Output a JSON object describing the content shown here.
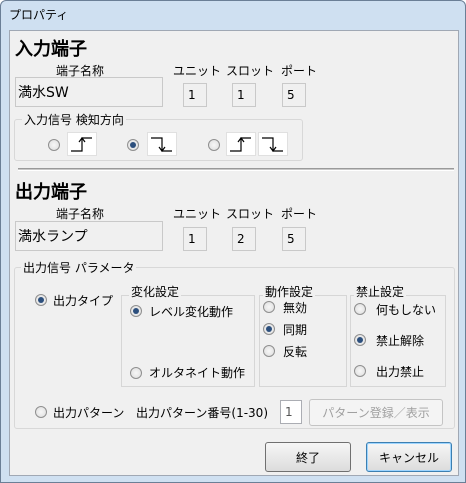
{
  "window": {
    "title": "プロパティ"
  },
  "input_terminal": {
    "heading": "入力端子",
    "name_label": "端子名称",
    "unit_label": "ユニット",
    "slot_label": "スロット",
    "port_label": "ポート",
    "name": "満水SW",
    "unit": "1",
    "slot": "1",
    "port": "5",
    "detect_group_label": "入力信号 検知方向",
    "detect_options": [
      {
        "icon": "rising-edge-icon",
        "checked": false
      },
      {
        "icon": "falling-edge-icon",
        "checked": true
      },
      {
        "icon": "both-edges-icon",
        "checked": false
      }
    ]
  },
  "output_terminal": {
    "heading": "出力端子",
    "name_label": "端子名称",
    "unit_label": "ユニット",
    "slot_label": "スロット",
    "port_label": "ポート",
    "name": "満水ランプ",
    "unit": "1",
    "slot": "2",
    "port": "5"
  },
  "output_params": {
    "group_label": "出力信号 パラメータ",
    "output_type_label": "出力タイプ",
    "output_type_checked": true,
    "change_group_label": "変化設定",
    "level_change_label": "レベル変化動作",
    "level_change_checked": true,
    "alternate_label": "オルタネイト動作",
    "alternate_checked": false,
    "action_group_label": "動作設定",
    "action_options": [
      {
        "label": "無効",
        "checked": false
      },
      {
        "label": "同期",
        "checked": true
      },
      {
        "label": "反転",
        "checked": false
      }
    ],
    "prohibit_group_label": "禁止設定",
    "prohibit_options": [
      {
        "label": "何もしない",
        "checked": false
      },
      {
        "label": "禁止解除",
        "checked": true
      },
      {
        "label": "出力禁止",
        "checked": false
      }
    ],
    "output_pattern_label": "出力パターン",
    "output_pattern_checked": false,
    "pattern_number_label": "出力パターン番号(1-30)",
    "pattern_number_value": "1",
    "pattern_register_label": "パターン登録／表示"
  },
  "buttons": {
    "ok_label": "終了",
    "cancel_label": "キャンセル"
  }
}
